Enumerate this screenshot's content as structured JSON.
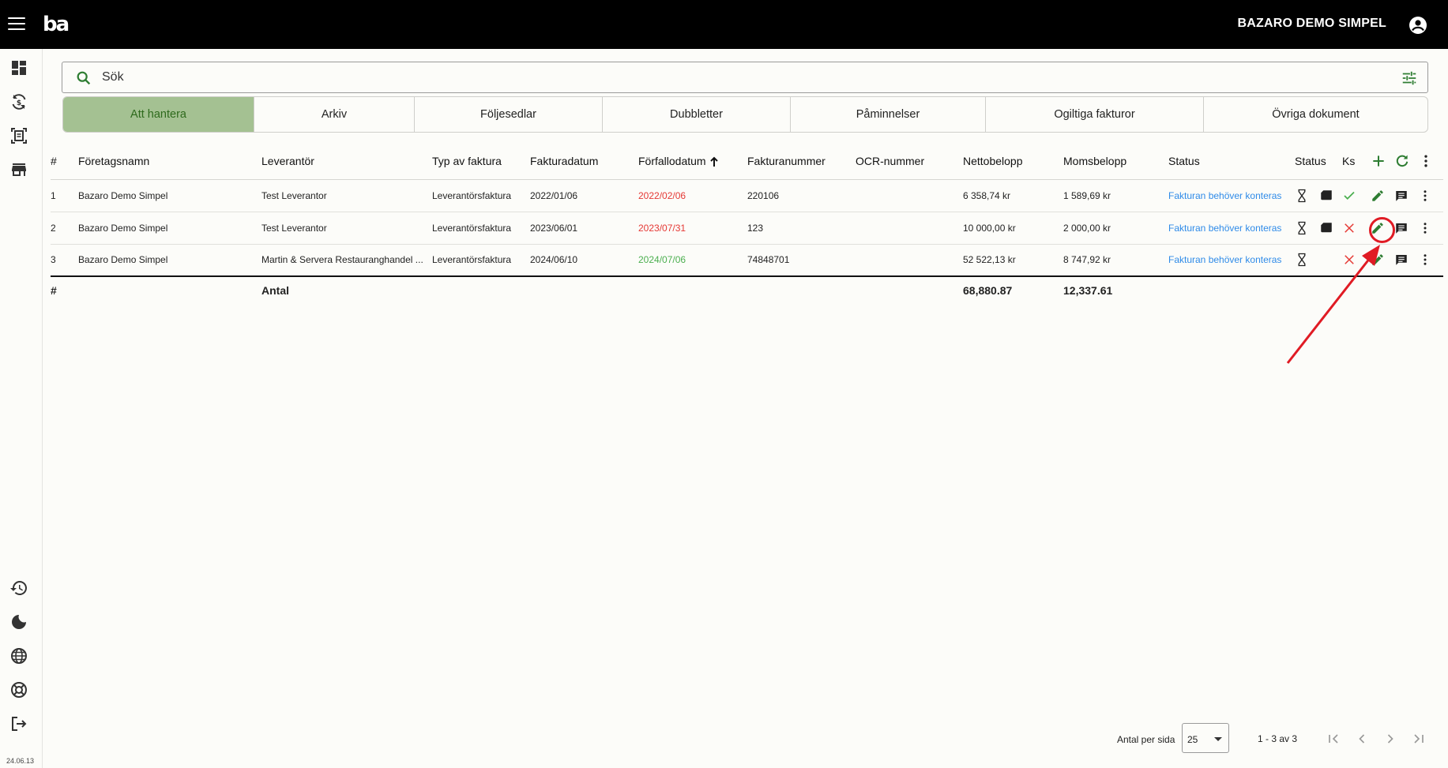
{
  "header": {
    "company": "BAZARO DEMO SIMPEL",
    "logo": "ba"
  },
  "sidebar": {
    "top_icons": [
      "dashboard-icon",
      "currency-exchange-icon",
      "document-scanner-icon",
      "store-icon"
    ],
    "bottom_icons": [
      "history-icon",
      "dark-mode-icon",
      "language-icon",
      "support-icon",
      "logout-icon"
    ],
    "version": "24.06.13"
  },
  "search": {
    "placeholder": "Sök"
  },
  "tabs": [
    {
      "label": "Att hantera",
      "active": true
    },
    {
      "label": "Arkiv"
    },
    {
      "label": "Följesedlar"
    },
    {
      "label": "Dubbletter"
    },
    {
      "label": "Påminnelser"
    },
    {
      "label": "Ogiltiga fakturor"
    },
    {
      "label": "Övriga dokument"
    }
  ],
  "table": {
    "headers": {
      "num": "#",
      "company": "Företagsnamn",
      "supplier": "Leverantör",
      "type": "Typ av faktura",
      "invoice_date": "Fakturadatum",
      "due_date": "Förfallodatum",
      "invoice_no": "Fakturanummer",
      "ocr": "OCR-nummer",
      "net": "Nettobelopp",
      "vat": "Momsbelopp",
      "status": "Status",
      "status_icons": "Status",
      "ks": "Ks"
    },
    "rows": [
      {
        "num": "1",
        "company": "Bazaro Demo Simpel",
        "supplier": "Test Leverantor",
        "type": "Leverantörsfaktura",
        "invoice_date": "2022/01/06",
        "due_date": "2022/02/06",
        "due_color": "red",
        "invoice_no": "220106",
        "ocr": "",
        "net": "6 358,74 kr",
        "vat": "1 589,69 kr",
        "status": "Fakturan behöver konteras",
        "has_doc": true,
        "ks": "check"
      },
      {
        "num": "2",
        "company": "Bazaro Demo Simpel",
        "supplier": "Test Leverantor",
        "type": "Leverantörsfaktura",
        "invoice_date": "2023/06/01",
        "due_date": "2023/07/31",
        "due_color": "red",
        "invoice_no": "123",
        "ocr": "",
        "net": "10 000,00 kr",
        "vat": "2 000,00 kr",
        "status": "Fakturan behöver konteras",
        "has_doc": true,
        "ks": "close"
      },
      {
        "num": "3",
        "company": "Bazaro Demo Simpel",
        "supplier": "Martin & Servera Restauranghandel ...",
        "type": "Leverantörsfaktura",
        "invoice_date": "2024/06/10",
        "due_date": "2024/07/06",
        "due_color": "green",
        "invoice_no": "74848701",
        "ocr": "",
        "net": "52 522,13 kr",
        "vat": "8 747,92 kr",
        "status": "Fakturan behöver konteras",
        "has_doc": false,
        "ks": "close"
      }
    ],
    "totals": {
      "num": "#",
      "label": "Antal",
      "net": "68,880.87",
      "vat": "12,337.61"
    }
  },
  "colors": {
    "accent_green": "#2e7d32",
    "active_tab": "#a4c192",
    "overdue_red": "#e53935",
    "ok_green": "#4caf50",
    "link_blue": "#2f8be8",
    "annotation_red": "#e01b24"
  },
  "pagination": {
    "per_page_label": "Antal per sida",
    "per_page_value": "25",
    "range": "1 - 3 av 3"
  }
}
